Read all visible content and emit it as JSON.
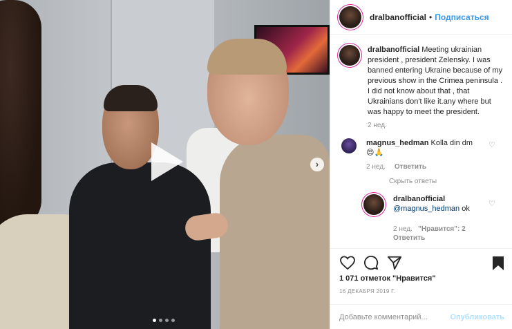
{
  "post": {
    "author": "dralbanofficial",
    "separator": "•",
    "follow_label": "Подписаться",
    "caption_author": "dralbanofficial",
    "caption_text": "Meeting ukrainian president , president Zelensky. I was banned entering Ukraine because of my previous show in the Crimea peninsula . I did not know about that , that Ukrainians don't like it.any where but was happy to meet the president.",
    "caption_age": "2 нед.",
    "likes": "1 071 отметок \"Нравится\"",
    "date": "16 ДЕКАБРЯ 2019 Г.",
    "comment_placeholder": "Добавьте комментарий...",
    "publish_label": "Опубликовать"
  },
  "comments": [
    {
      "author": "magnus_hedman",
      "text": "Kolla din dm",
      "emoji": "😍🙏",
      "age": "2 нед.",
      "reply_label": "Ответить",
      "hide_replies": "Скрыть ответы",
      "replies": [
        {
          "author": "dralbanofficial",
          "mention": "@magnus_hedman",
          "text": "ok",
          "age": "2 нед.",
          "likes": "\"Нравится\": 2",
          "reply_label": "Ответить"
        }
      ]
    }
  ],
  "media": {
    "type": "video",
    "carousel_index": 1,
    "carousel_count": 4
  },
  "icons": {
    "like": "heart-icon",
    "comment": "comment-icon",
    "share": "share-icon",
    "save": "bookmark-icon",
    "next": "chevron-right-icon",
    "play": "play-icon"
  },
  "colors": {
    "accent": "#3897f0",
    "muted": "#8e8e8e",
    "publish_disabled": "#b2dffc"
  }
}
